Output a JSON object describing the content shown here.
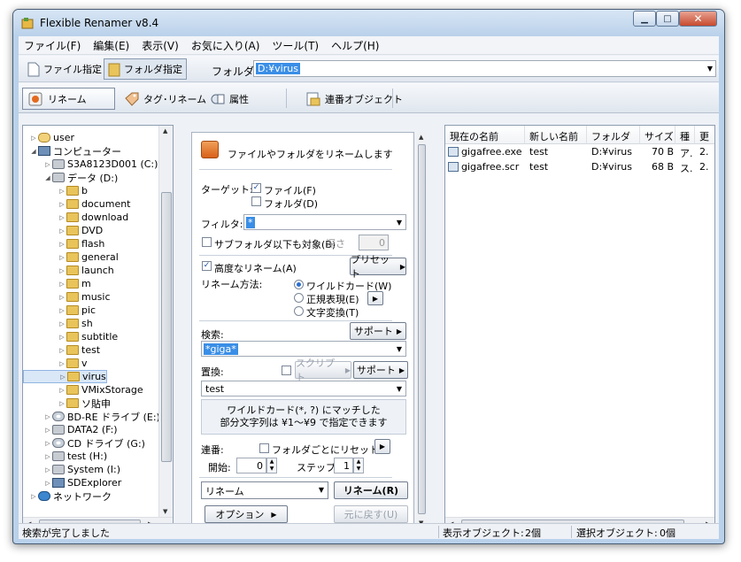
{
  "window": {
    "title": "Flexible Renamer v8.4"
  },
  "menu": [
    "ファイル(F)",
    "編集(E)",
    "表示(V)",
    "お気に入り(A)",
    "ツール(T)",
    "ヘルプ(H)"
  ],
  "toolbar": {
    "file_mode": "ファイル指定",
    "folder_mode": "フォルダ指定",
    "folder_label": "フォルダ",
    "folder_path": "D:¥virus"
  },
  "modes": {
    "rename": "リネーム",
    "tag_rename": "タグ･リネーム",
    "attributes": "属性",
    "serial_object": "連番オブジェクト"
  },
  "tree": [
    {
      "label": "user",
      "icon": "user-folder-icon",
      "indent": 0
    },
    {
      "label": "コンピューター",
      "icon": "computer-icon",
      "indent": 0
    },
    {
      "label": "S3A8123D001 (C:)",
      "icon": "drive-icon",
      "indent": 1
    },
    {
      "label": "データ (D:)",
      "icon": "drive-icon",
      "indent": 1
    },
    {
      "label": "b",
      "icon": "folder-icon",
      "indent": 2
    },
    {
      "label": "document",
      "icon": "folder-icon",
      "indent": 2
    },
    {
      "label": "download",
      "icon": "folder-icon",
      "indent": 2
    },
    {
      "label": "DVD",
      "icon": "folder-icon",
      "indent": 2
    },
    {
      "label": "flash",
      "icon": "folder-icon",
      "indent": 2
    },
    {
      "label": "general",
      "icon": "folder-icon",
      "indent": 2
    },
    {
      "label": "launch",
      "icon": "folder-icon",
      "indent": 2
    },
    {
      "label": "m",
      "icon": "folder-icon",
      "indent": 2
    },
    {
      "label": "music",
      "icon": "folder-icon",
      "indent": 2
    },
    {
      "label": "pic",
      "icon": "folder-icon",
      "indent": 2
    },
    {
      "label": "sh",
      "icon": "folder-icon",
      "indent": 2
    },
    {
      "label": "subtitle",
      "icon": "folder-icon",
      "indent": 2
    },
    {
      "label": "test",
      "icon": "folder-icon",
      "indent": 2
    },
    {
      "label": "v",
      "icon": "folder-icon",
      "indent": 2
    },
    {
      "label": "virus",
      "icon": "folder-icon",
      "indent": 2
    },
    {
      "label": "VMixStorage",
      "icon": "folder-icon",
      "indent": 2
    },
    {
      "label": "ソ貼申",
      "icon": "folder-icon",
      "indent": 2
    },
    {
      "label": "BD-RE ドライブ (E:) A",
      "icon": "cd-drive-icon",
      "indent": 1
    },
    {
      "label": "DATA2 (F:)",
      "icon": "drive-icon",
      "indent": 1
    },
    {
      "label": "CD ドライブ (G:)",
      "icon": "cd-drive-icon",
      "indent": 1
    },
    {
      "label": "test (H:)",
      "icon": "drive-icon",
      "indent": 1
    },
    {
      "label": "System (I:)",
      "icon": "drive-icon",
      "indent": 1
    },
    {
      "label": "SDExplorer",
      "icon": "computer-icon",
      "indent": 1
    },
    {
      "label": "ネットワーク",
      "icon": "network-icon",
      "indent": 0
    }
  ],
  "rename_panel": {
    "header": "ファイルやフォルダをリネームします",
    "target_label": "ターゲット:",
    "target_file": "ファイル(F)",
    "target_folder": "フォルダ(D)",
    "filter_label": "フィルタ:",
    "filter_value": "*",
    "subfolder_label": "サブフォルダ以下も対象(B)",
    "depth_label": "深さ",
    "depth_value": "0",
    "advanced_label": "高度なリネーム(A)",
    "preset_button": "プリセット",
    "method_label": "リネーム方法:",
    "method_wildcard": "ワイルドカード(W)",
    "method_regex": "正規表現(E)",
    "method_text": "文字変換(T)",
    "search_label": "検索:",
    "support_button": "サポート",
    "search_value": "*giga*",
    "replace_label": "置換:",
    "script_button": "スクリプト",
    "replace_value": "test",
    "info_line1": "ワイルドカード(*, ?) にマッチした",
    "info_line2": "部分文字列は ¥1～¥9 で指定できます",
    "serial_label": "連番:",
    "serial_reset": "フォルダごとにリセット",
    "start_label": "開始:",
    "start_value": "0",
    "step_label": "ステップ:",
    "step_value": "1",
    "action_select": "リネーム",
    "rename_button": "リネーム(R)",
    "options_button": "オプション",
    "undo_button": "元に戻す(U)"
  },
  "list": {
    "columns": [
      "現在の名前",
      "新しい名前",
      "フォルダ",
      "サイズ",
      "種",
      "更"
    ],
    "rows": [
      [
        "gigafree.exe",
        "test",
        "D:¥virus",
        "70 B",
        "ア.",
        "2."
      ],
      [
        "gigafree.scr",
        "test",
        "D:¥virus",
        "68 B",
        "ス.",
        "2."
      ]
    ]
  },
  "status": {
    "message": "検索が完了しました",
    "shown_label": "表示オブジェクト:",
    "shown_value": "2個",
    "selected_label": "選択オブジェクト:",
    "selected_value": "0個"
  }
}
